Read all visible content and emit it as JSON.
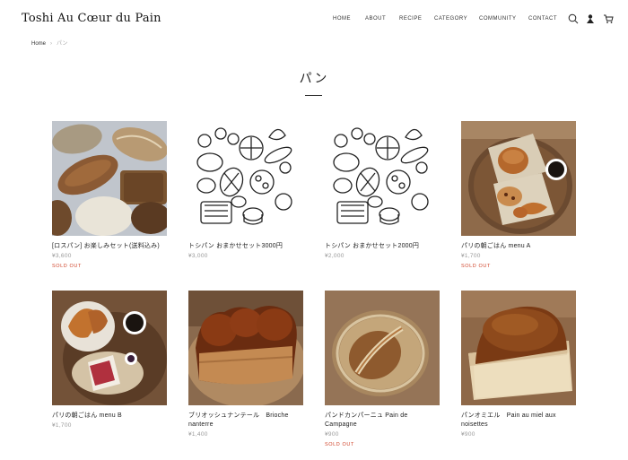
{
  "header": {
    "logo": "Toshi Au Cœur du Pain",
    "nav": [
      "HOME",
      "ABOUT",
      "RECIPE",
      "CATEGORY",
      "COMMUNITY",
      "CONTACT"
    ]
  },
  "icons": [
    "search-icon",
    "user-icon",
    "cart-icon"
  ],
  "breadcrumb": {
    "home": "Home",
    "separator": "›",
    "current": "パン"
  },
  "page": {
    "title": "パン"
  },
  "products": [
    {
      "name": "[ロスパン] お楽しみセット(送料込み)",
      "price": "¥3,600",
      "status": "SOLD OUT"
    },
    {
      "name": "トシパン おまかせセット3000円",
      "price": "¥3,000",
      "status": ""
    },
    {
      "name": "トシパン おまかせセット2000円",
      "price": "¥2,000",
      "status": ""
    },
    {
      "name": "パリの朝ごはん menu A",
      "price": "¥1,700",
      "status": "SOLD OUT"
    },
    {
      "name": "パリの朝ごはん menu B",
      "price": "¥1,700",
      "status": ""
    },
    {
      "name": "ブリオッシュナンテール　Brioche nanterre",
      "price": "¥1,400",
      "status": ""
    },
    {
      "name": "パンドカンパーニュ Pain de Campagne",
      "price": "¥900",
      "status": "SOLD OUT"
    },
    {
      "name": "パンオミエル　Pain au miel aux noisettes",
      "price": "¥900",
      "status": ""
    }
  ],
  "colors": {
    "sold_out": "#d0442a",
    "price": "#999999",
    "text": "#222222"
  }
}
